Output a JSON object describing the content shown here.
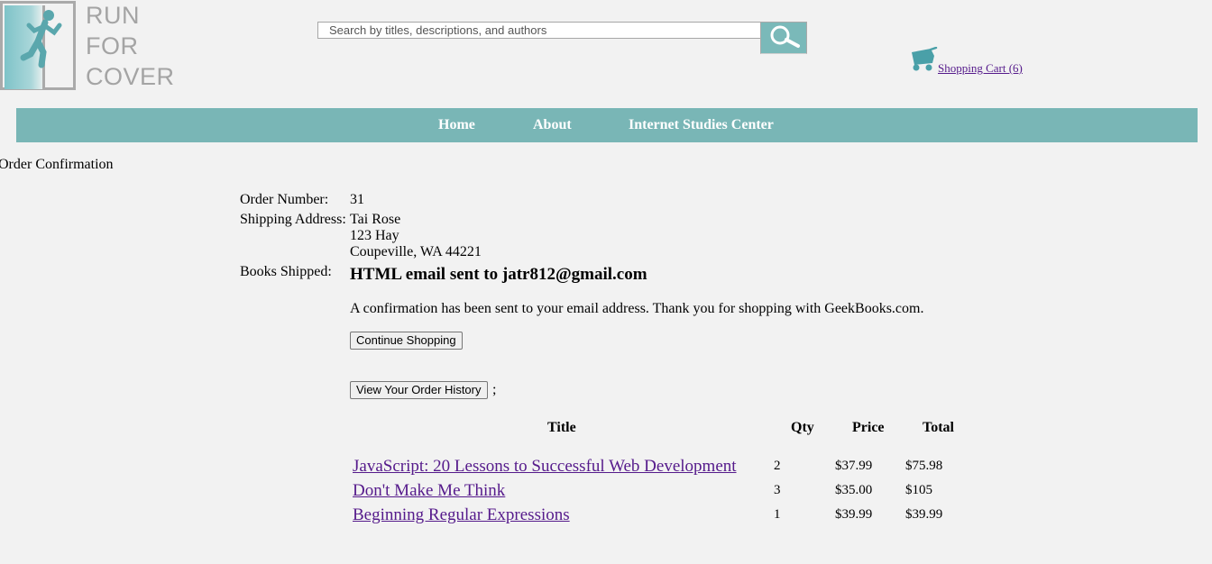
{
  "logo": {
    "lines": [
      "RUN",
      "FOR",
      "COVER"
    ],
    "icon": "running-man-door-icon"
  },
  "search": {
    "placeholder": "Search by titles, descriptions, and authors",
    "icon": "magnifier-icon"
  },
  "cart": {
    "label": "Shopping Cart (6)",
    "icon": "shopping-cart-icon"
  },
  "nav": {
    "items": [
      "Home",
      "About",
      "Internet Studies Center"
    ]
  },
  "page": {
    "heading": "Order Confirmation"
  },
  "order": {
    "number_label": "Order Number:",
    "number": "31",
    "address_label": "Shipping Address:",
    "address_lines": [
      "Tai Rose",
      "123 Hay",
      "Coupeville, WA 44221"
    ],
    "books_label": "Books Shipped:"
  },
  "email_heading": "HTML email sent to jatr812@gmail.com",
  "confirmation_text": "A confirmation has been sent to your email address. Thank you for shopping with GeekBooks.com.",
  "buttons": {
    "continue": "Continue Shopping",
    "history": "View Your Order History",
    "history_suffix": ";"
  },
  "table": {
    "headers": {
      "title": "Title",
      "qty": "Qty",
      "price": "Price",
      "total": "Total"
    },
    "rows": [
      {
        "title": "JavaScript: 20 Lessons to Successful Web Development",
        "qty": "2",
        "price": "$37.99",
        "total": "$75.98"
      },
      {
        "title": "Don't Make Me Think",
        "qty": "3",
        "price": "$35.00",
        "total": "$105"
      },
      {
        "title": "Beginning Regular Expressions",
        "qty": "1",
        "price": "$39.99",
        "total": "$39.99"
      }
    ]
  },
  "colors": {
    "teal": "#79b6b6",
    "background": "#f2f2f2",
    "link": "#551a8b"
  }
}
